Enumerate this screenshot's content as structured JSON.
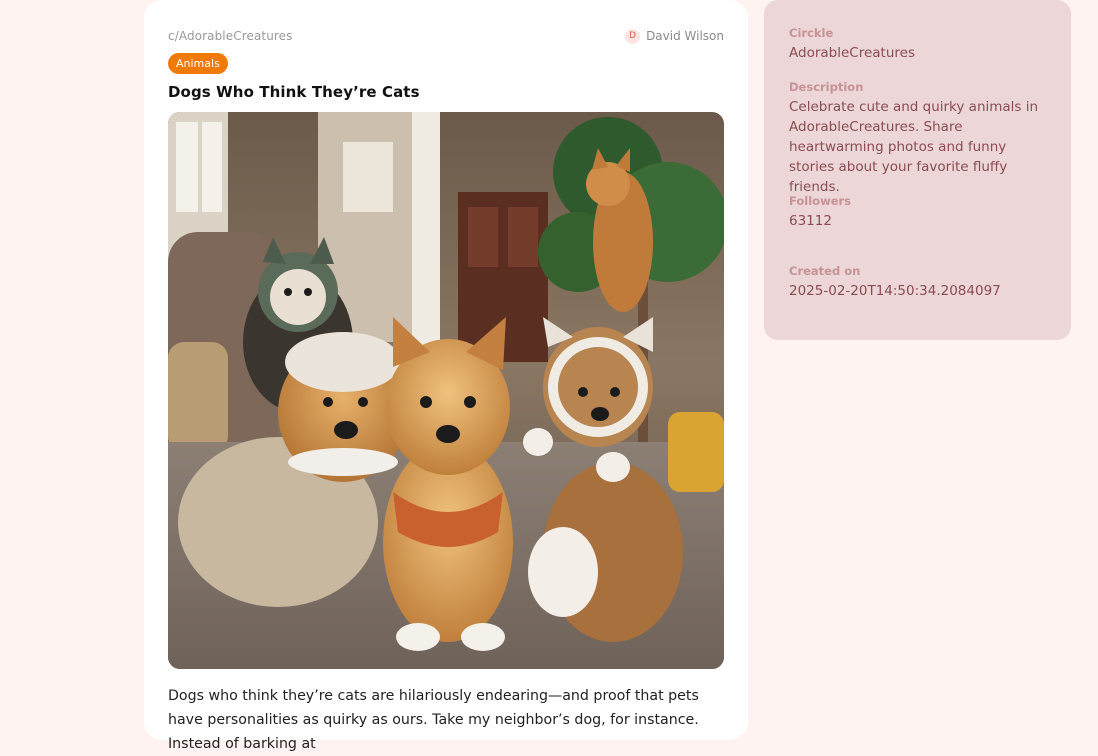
{
  "post": {
    "community": "c/AdorableCreatures",
    "author_initial": "D",
    "author_name": "David Wilson",
    "tag": "Animals",
    "title": "Dogs Who Think They’re Cats",
    "image_icon": "photo-dogs-in-cat-costumes",
    "body": "Dogs who think they’re cats are hilariously endearing—and proof that pets have personalities as quirky as ours. Take my neighbor’s dog, for instance. Instead of barking at"
  },
  "sidebar": {
    "circkle_label": "Circkle",
    "circkle_value": "AdorableCreatures",
    "description_label": "Description",
    "description_value": "Celebrate cute and quirky animals in AdorableCreatures. Share heartwarming photos and funny stories about your favorite fluffy friends.",
    "followers_label": "Followers",
    "followers_value": "63112",
    "created_label": "Created on",
    "created_value": "2025-02-20T14:50:34.2084097"
  },
  "colors": {
    "page_background": "#fff3f1",
    "tag_background": "#ef7a06",
    "sidebar_background": "#ecd6d7",
    "sidebar_label": "#c79296",
    "sidebar_value": "#8a4c53"
  }
}
